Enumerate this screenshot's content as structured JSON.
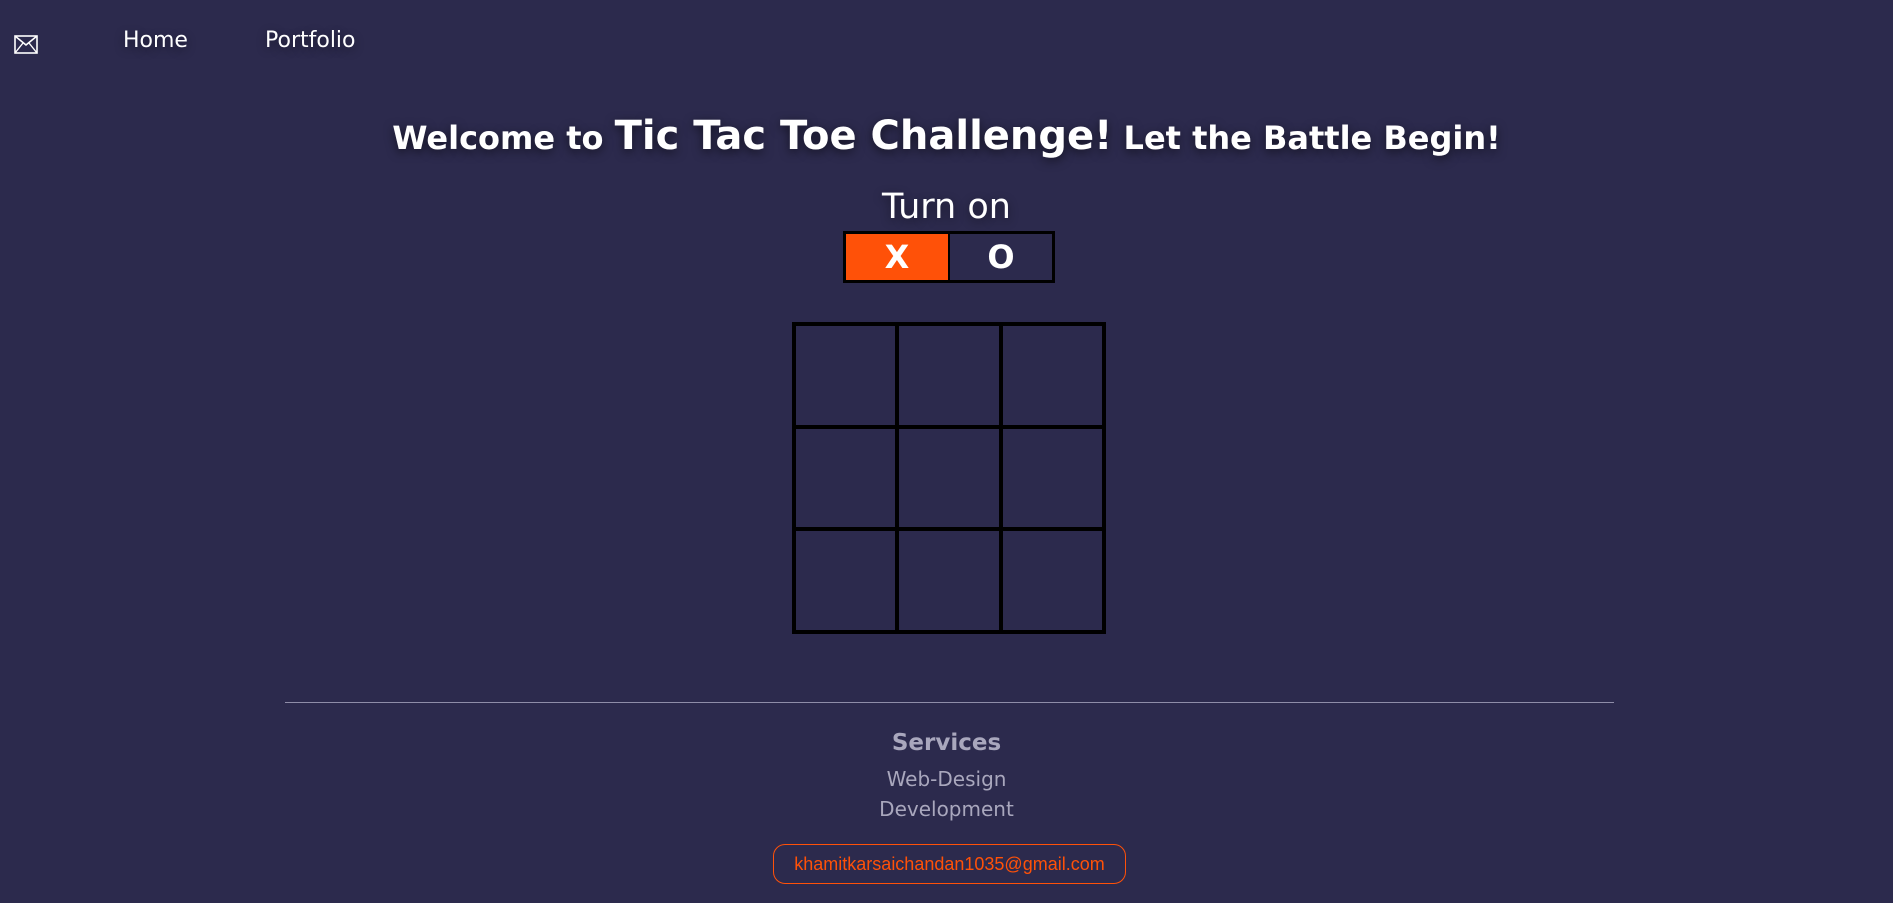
{
  "nav": {
    "mail_icon": "mail-icon",
    "home": "Home",
    "portfolio": "Portfolio"
  },
  "headline": {
    "prefix": "Welcome to",
    "title": "Tic Tac Toe Challenge!",
    "suffix": "Let the Battle Begin!"
  },
  "turn": {
    "label": "Turn on",
    "x": "X",
    "o": "O",
    "active": "X"
  },
  "board": {
    "cells": [
      "",
      "",
      "",
      "",
      "",
      "",
      "",
      "",
      ""
    ]
  },
  "footer": {
    "heading": "Services",
    "links": [
      "Web-Design",
      "Development"
    ],
    "email": "khamitkarsaichandan1035@gmail.com"
  },
  "colors": {
    "background": "#2c2a4d",
    "accent": "#ff5108",
    "footer_text": "#a9a7bd"
  }
}
